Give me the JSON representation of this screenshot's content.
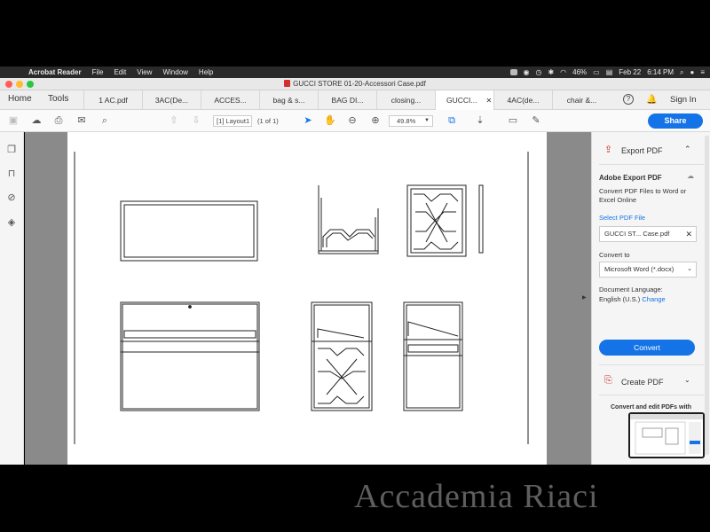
{
  "menubar": {
    "app_name": "Acrobat Reader",
    "menus": [
      "File",
      "Edit",
      "View",
      "Window",
      "Help"
    ],
    "battery": "46%",
    "date": "Feb 22",
    "time": "6:14 PM"
  },
  "window": {
    "title": "GUCCI STORE 01-20-Accessori Case.pdf"
  },
  "tabs": {
    "home": "Home",
    "tools": "Tools",
    "documents": [
      "1 AC.pdf",
      "3AC(De...",
      "ACCES...",
      "bag & s...",
      "BAG DI...",
      "closing...",
      "GUCCI...",
      "4AC(de...",
      "chair &..."
    ],
    "active_index": 6,
    "signin": "Sign In"
  },
  "toolbar": {
    "page_label": "[1] Layout1",
    "page_count": "(1 of 1)",
    "zoom": "49.8%",
    "share_label": "Share"
  },
  "panel": {
    "header": "Export PDF",
    "title": "Adobe Export PDF",
    "description": "Convert PDF Files to Word or Excel Online",
    "select_label": "Select PDF File",
    "file_name": "GUCCI ST... Case.pdf",
    "convert_to_label": "Convert to",
    "convert_to_value": "Microsoft Word (*.docx)",
    "language_label": "Document Language:",
    "language_value": "English (U.S.)",
    "change_link": "Change",
    "convert_button": "Convert",
    "create_pdf": "Create PDF",
    "promo": "Convert and edit PDFs with"
  },
  "watermark": "Accademia Riaci",
  "colors": {
    "accent": "#1473e6",
    "acrobat_red": "#d32f2f",
    "doc_background": "#8a8a8a"
  }
}
